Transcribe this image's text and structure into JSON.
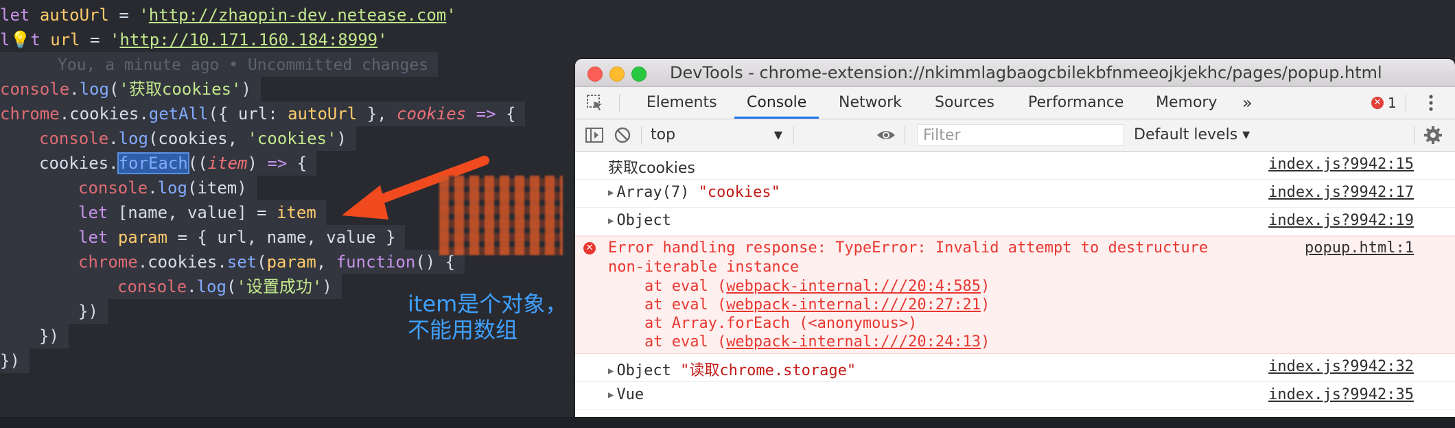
{
  "editor": {
    "lines": {
      "l1_kw": "let",
      "l1_var": "autoUrl",
      "l1_eq": " = ",
      "l1_q1": "'",
      "l1_url": "http://zhaopin-dev.netease.com",
      "l1_q2": "'",
      "l2_a": "l",
      "l2_b": "t",
      "l2_var": "url",
      "l2_url": "http://10.171.160.184:8999",
      "blame": "You, a minute ago • Uncommitted changes",
      "l4_log_arg": "'获取cookies'",
      "l5_param": "cookies",
      "l6_str": "'cookies'",
      "l7_method": "forEach",
      "l9_text": "let [name, value] = item",
      "l10_text": "let param = { url, name, value }",
      "l12_str": "'设置成功'"
    },
    "annotation_line1": "item是个对象，",
    "annotation_line2": "不能用数组"
  },
  "devtools": {
    "window_title": "DevTools - chrome-extension://nkimmlagbaogcbilekbfnmeeojkjekhc/pages/popup.html",
    "tabs": [
      "Elements",
      "Console",
      "Network",
      "Sources",
      "Performance",
      "Memory"
    ],
    "more_tabs": "»",
    "error_count": "1",
    "context": "top",
    "filter_placeholder": "Filter",
    "levels": "Default levels ▾",
    "rows": [
      {
        "msg": "获取cookies",
        "src": "index.js?9942:15"
      },
      {
        "msg_a": "Array(7) ",
        "msg_b": "\"cookies\"",
        "src": "index.js?9942:17"
      },
      {
        "msg": "Object",
        "src": "index.js?9942:19"
      },
      {
        "msg_a": "Object ",
        "msg_b": "\"读取chrome.storage\"",
        "src": "index.js?9942:32"
      },
      {
        "msg": "Vue",
        "src": "index.js?9942:35"
      }
    ],
    "error": {
      "line1": "Error handling response: TypeError: Invalid attempt to destructure",
      "line2": "non-iterable instance",
      "src": "popup.html:1",
      "stack": [
        {
          "pre": "    at eval (",
          "link": "webpack-internal:///20:4:585",
          "post": ")"
        },
        {
          "pre": "    at eval (",
          "link": "webpack-internal:///20:27:21",
          "post": ")"
        },
        {
          "pre": "    at Array.forEach (<anonymous>)",
          "link": "",
          "post": ""
        },
        {
          "pre": "    at eval (",
          "link": "webpack-internal:///20:24:13",
          "post": ")"
        }
      ]
    }
  }
}
